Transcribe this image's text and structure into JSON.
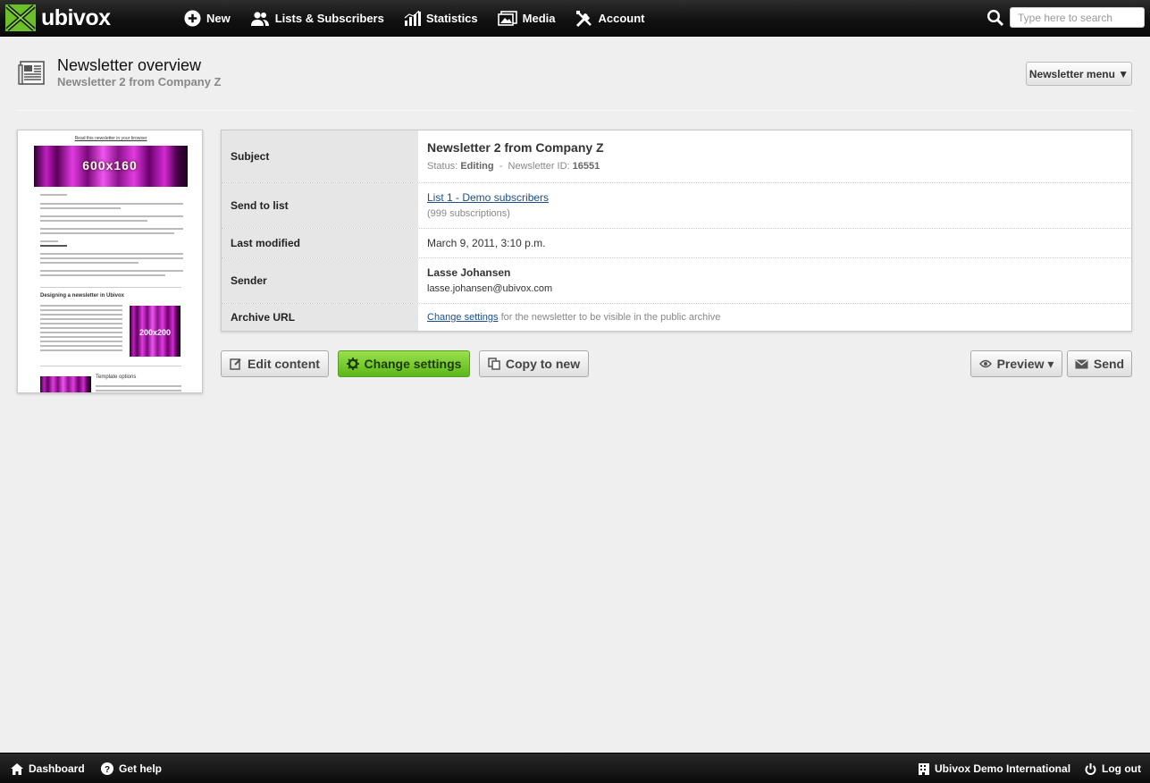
{
  "app": {
    "name": "ubivox",
    "brand_color": "#6abf2a"
  },
  "nav": [
    {
      "label": "New",
      "icon": "plus-circle-icon"
    },
    {
      "label": "Lists & Subscribers",
      "icon": "users-icon"
    },
    {
      "label": "Statistics",
      "icon": "bar-chart-icon"
    },
    {
      "label": "Media",
      "icon": "images-icon"
    },
    {
      "label": "Account",
      "icon": "tools-icon"
    }
  ],
  "search": {
    "placeholder": "Type here to search"
  },
  "header": {
    "title": "Newsletter overview",
    "subtitle": "Newsletter 2 from Company Z",
    "menu_label": "Newsletter menu ▼"
  },
  "thumbnail": {
    "top_link": "Read this newsletter in your browser",
    "banner_label": "600x160",
    "section1_title": "Designing a newsletter in Ubivox",
    "image2_label": "200x200",
    "section2_title": "Template options"
  },
  "details": {
    "subject_label": "Subject",
    "subject_value": "Newsletter 2 from Company Z",
    "status_prefix": "Status:",
    "status_value": "Editing",
    "status_sep": "-",
    "id_prefix": "Newsletter ID:",
    "id_value": "16551",
    "send_label": "Send to list",
    "list_name": "List 1 - Demo subscribers",
    "list_count": "(999 subscriptions)",
    "modified_label": "Last modified",
    "modified_value": "March 9, 2011, 3:10 p.m.",
    "sender_label": "Sender",
    "sender_name": "Lasse Johansen",
    "sender_email": "lasse.johansen@ubivox.com",
    "archive_label": "Archive URL",
    "archive_link": "Change settings",
    "archive_text": "for the newsletter to be visible in the public archive"
  },
  "actions": {
    "edit": "Edit content",
    "settings": "Change settings",
    "copy": "Copy to new",
    "preview": "Preview ▾",
    "send": "Send"
  },
  "footer": {
    "dashboard": "Dashboard",
    "help": "Get help",
    "org": "Ubivox Demo International",
    "logout": "Log out"
  }
}
